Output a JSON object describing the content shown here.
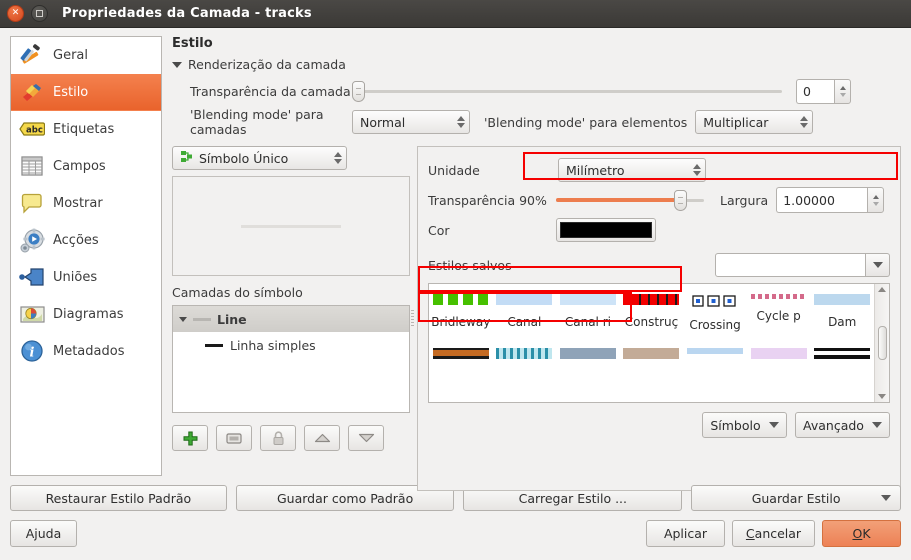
{
  "window": {
    "title": "Propriedades da Camada - tracks",
    "close_icon": "close-icon",
    "maximize_icon": "maximize-icon"
  },
  "sidebar": {
    "items": [
      {
        "label": "Geral",
        "icon": "tools-icon",
        "selected": false
      },
      {
        "label": "Estilo",
        "icon": "brush-icon",
        "selected": true
      },
      {
        "label": "Etiquetas",
        "icon": "abc-icon",
        "selected": false
      },
      {
        "label": "Campos",
        "icon": "table-icon",
        "selected": false
      },
      {
        "label": "Mostrar",
        "icon": "balloon-icon",
        "selected": false
      },
      {
        "label": "Acções",
        "icon": "gear-play-icon",
        "selected": false
      },
      {
        "label": "Uniões",
        "icon": "join-arrow-icon",
        "selected": false
      },
      {
        "label": "Diagramas",
        "icon": "pie-map-icon",
        "selected": false
      },
      {
        "label": "Metadados",
        "icon": "info-icon",
        "selected": false
      }
    ]
  },
  "pane": {
    "title": "Estilo",
    "render_group": "Renderização da camada",
    "layer_transparency_label": "Transparência da camada",
    "layer_transparency_value": "0",
    "layer_transparency_percent": 0,
    "blending_layers_label": "'Blending mode' para camadas",
    "blending_layers_value": "Normal",
    "blending_features_label": "'Blending mode' para elementos",
    "blending_features_value": "Multiplicar",
    "renderer_value": "Símbolo Único",
    "renderer_icon": "single-symbol-icon",
    "symbol_layers_label": "Camadas do símbolo",
    "tree": {
      "root_label": "Line",
      "child_label": "Linha simples"
    },
    "layer_buttons": [
      {
        "name": "add-symbol-layer-button",
        "icon": "plus-icon",
        "disabled": false
      },
      {
        "name": "remove-symbol-layer-button",
        "icon": "minus-icon",
        "disabled": false
      },
      {
        "name": "lock-symbol-layer-button",
        "icon": "lock-icon",
        "disabled": true
      },
      {
        "name": "move-up-button",
        "icon": "arrow-up-icon",
        "disabled": false
      },
      {
        "name": "move-down-button",
        "icon": "arrow-down-icon",
        "disabled": false
      }
    ]
  },
  "properties": {
    "unit_label": "Unidade",
    "unit_value": "Milímetro",
    "transparency_label": "Transparência 90%",
    "transparency_percent": 90,
    "color_label": "Cor",
    "color_value": "#000000",
    "width_label": "Largura",
    "width_value": "1.00000",
    "saved_styles_label": "Estilos salvos",
    "saved_styles_value": "",
    "symbol_button": "Símbolo",
    "advanced_button": "Avançado"
  },
  "gallery": {
    "row1": [
      {
        "name": "Bridleway",
        "swatch": "dashed-green",
        "color": "#46c000"
      },
      {
        "name": "Canal",
        "swatch": "solid-lightblue",
        "color": "#c3dcf5"
      },
      {
        "name": "Canal ri",
        "swatch": "solid-lightblue",
        "color": "#cde3f7"
      },
      {
        "name": "Construç",
        "swatch": "dashed-red",
        "color": "#f20000"
      },
      {
        "name": "Crossing",
        "swatch": "marker-box",
        "color": "#1f5fd0"
      },
      {
        "name": "Cycle p",
        "swatch": "dotted-pink",
        "color": "#d46a8a"
      },
      {
        "name": "Dam",
        "swatch": "solid-lightblue",
        "color": "#bcd8ee"
      }
    ],
    "row2": [
      {
        "swatch": "double-orange",
        "color": "#c46a22"
      },
      {
        "swatch": "dotted-cyan",
        "color": "#73c4d4"
      },
      {
        "swatch": "solid-steel",
        "color": "#8fa3b8"
      },
      {
        "swatch": "solid-tan",
        "color": "#c3ab97"
      },
      {
        "swatch": "solid-skyblue",
        "color": "#bad6f0"
      },
      {
        "swatch": "solid-lilac",
        "color": "#e9d2f2"
      },
      {
        "swatch": "double-black",
        "color": "#111111"
      }
    ]
  },
  "footer": {
    "restore_default": "Restaurar Estilo Padrão",
    "save_default": "Guardar como Padrão",
    "load_style": "Carregar Estilo ...",
    "save_style": "Guardar Estilo",
    "help": "Ajuda",
    "apply": "Aplicar",
    "cancel": "Cancelar",
    "ok": "OK"
  },
  "colors": {
    "accent_orange": "#ed7d4e",
    "selection_orange": "#e9632c",
    "annotation_red": "#f50000",
    "titlebar": "#3f3e3b"
  }
}
